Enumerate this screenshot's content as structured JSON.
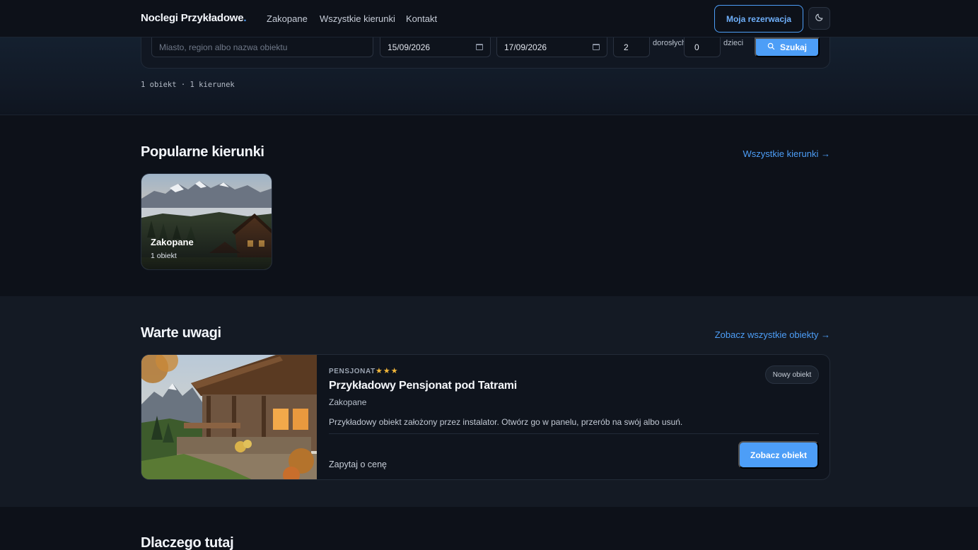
{
  "nav": {
    "brand": "Noclegi Przykładowe",
    "brand_dot": ".",
    "links": [
      "Zakopane",
      "Wszystkie kierunki",
      "Kontakt"
    ],
    "reservation_label": "Moja rezerwacja",
    "theme_icon": "moon-icon"
  },
  "search": {
    "location_placeholder": "Miasto, region albo nazwa obiektu",
    "check_in": "15/09/2026",
    "check_out": "17/09/2026",
    "adults_value": "2",
    "adults_label": "dorosłych",
    "children_value": "0",
    "children_label": "dzieci",
    "submit_label": "Szukaj",
    "summary": "1 obiekt · 1 kierunek"
  },
  "popular": {
    "title": "Popularne kierunki",
    "link": "Wszystkie kierunki →",
    "destinations": [
      {
        "name": "Zakopane",
        "count": "1 obiekt"
      }
    ]
  },
  "featured": {
    "title": "Warte uwagi",
    "link": "Zobacz wszystkie obiekty →",
    "property": {
      "type": "PENSJONAT",
      "stars": "★★★",
      "name": "Przykładowy Pensjonat pod Tatrami",
      "city": "Zakopane",
      "description": "Przykładowy obiekt założony przez instalator. Otwórz go w panelu, przerób na swój albo usuń.",
      "badge": "Nowy obiekt",
      "price": "Zapytaj o cenę",
      "cta": "Zobacz obiekt"
    }
  },
  "why": {
    "title": "Dlaczego tutaj"
  },
  "colors": {
    "accent": "#4d9ef7",
    "background": "#0d1119",
    "section_alt": "#141a24",
    "star": "#f2b73a"
  }
}
